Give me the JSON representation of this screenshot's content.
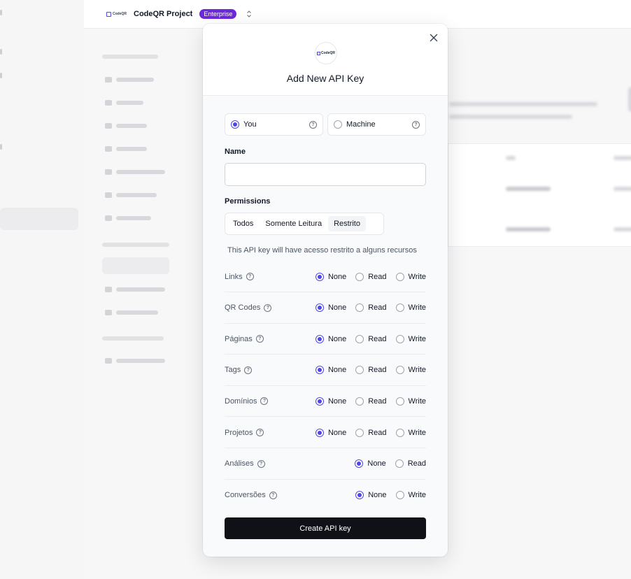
{
  "topbar": {
    "logo_text": "CodeQR",
    "project_name": "CodeQR Project",
    "plan_badge": "Enterprise",
    "switcher_icon": "chevron-up-down-icon"
  },
  "modal": {
    "logo_text": "CodeQR",
    "title": "Add New API Key",
    "close_icon": "close-icon",
    "key_types": [
      {
        "label": "You",
        "selected": true
      },
      {
        "label": "Machine",
        "selected": false
      }
    ],
    "name_label": "Name",
    "name_value": "",
    "permissions_label": "Permissions",
    "permission_tabs": [
      {
        "label": "Todos",
        "active": false
      },
      {
        "label": "Somente Leitura",
        "active": false
      },
      {
        "label": "Restrito",
        "active": true
      }
    ],
    "note": "This API key will have acesso restrito a alguns recursos",
    "resources": [
      {
        "name": "Links",
        "options": [
          "None",
          "Read",
          "Write"
        ],
        "selected": "None"
      },
      {
        "name": "QR Codes",
        "options": [
          "None",
          "Read",
          "Write"
        ],
        "selected": "None"
      },
      {
        "name": "Páginas",
        "options": [
          "None",
          "Read",
          "Write"
        ],
        "selected": "None"
      },
      {
        "name": "Tags",
        "options": [
          "None",
          "Read",
          "Write"
        ],
        "selected": "None"
      },
      {
        "name": "Domínios",
        "options": [
          "None",
          "Read",
          "Write"
        ],
        "selected": "None"
      },
      {
        "name": "Projetos",
        "options": [
          "None",
          "Read",
          "Write"
        ],
        "selected": "None"
      },
      {
        "name": "Análises",
        "options": [
          "None",
          "Read"
        ],
        "selected": "None"
      },
      {
        "name": "Conversões",
        "options": [
          "None",
          "Write"
        ],
        "selected": "None"
      }
    ],
    "create_button": "Create API key"
  },
  "colors": {
    "accent": "#4f46e5",
    "badge": "#6d28d9",
    "primary_button": "#0f1117"
  }
}
